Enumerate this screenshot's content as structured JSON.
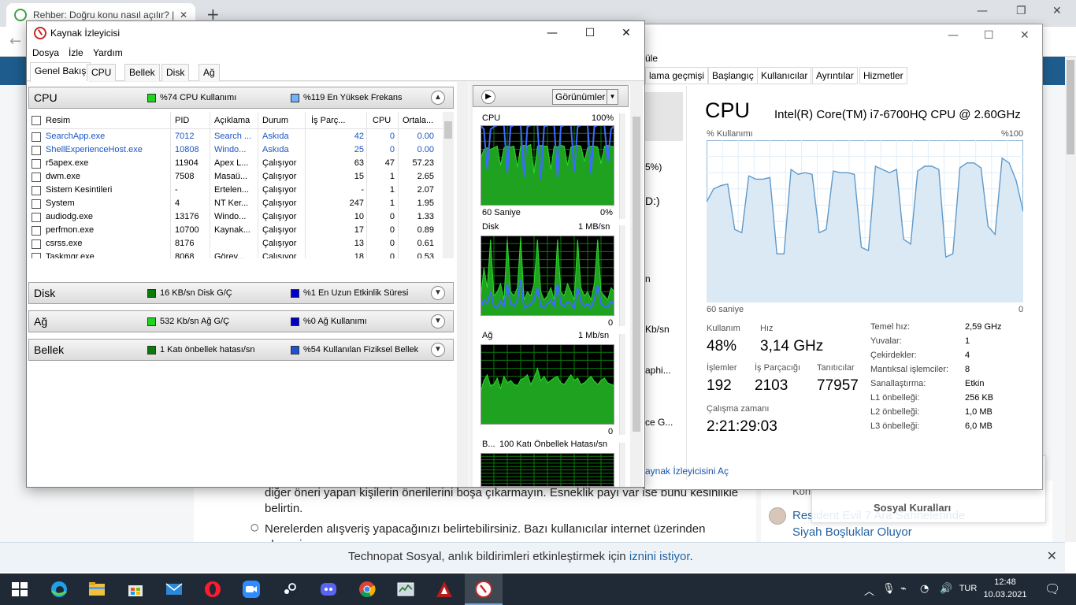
{
  "browser": {
    "tab_title": "Rehber: Doğru konu nasıl açılır? |",
    "tab_close": "✕",
    "new_tab": "+",
    "back": "←",
    "minimize": "—",
    "restore": "❐",
    "close": "✕",
    "article_line1": "diğer öneri yapan kişilerin önerilerini boşa çıkarmayın. Esneklik payı var ise bunu kesinlikle",
    "article_line2": "belirtin.",
    "article_line3": "Nerelerden alışveriş yapacağınızı belirtebilirsiniz. Bazı kullanıcılar internet üzerinden alışveriş",
    "side_prefix": "Kon",
    "side_link": "Resident Evil 7 Ara Sahnelerinde Siyah Boşluklar Oluyor",
    "social_popup_title": "Sosyal Kuralları",
    "notification": {
      "text": "Technopat Sosyal, anlık bildirimleri etkinleştirmek için ",
      "link": "iznini istiyor",
      "suffix": ".",
      "close": "✕"
    }
  },
  "task_manager": {
    "tabs": [
      "üle",
      "lama geçmişi",
      "Başlangıç",
      "Kullanıcılar",
      "Ayrıntılar",
      "Hizmetler"
    ],
    "partial_left": [
      "5%)",
      "D:)",
      "n",
      "Kb/sn",
      "aphi...",
      "ce G..."
    ],
    "title": "CPU",
    "cpu_model": "Intel(R) Core(TM) i7-6700HQ CPU @ 2.60GHz",
    "graph_label_left": "% Kullanımı",
    "graph_label_right": "%100",
    "graph_time_left": "60 saniye",
    "graph_time_right": "0",
    "usage_values": [
      62,
      70,
      72,
      73,
      45,
      43,
      78,
      76,
      76,
      77,
      30,
      30,
      82,
      79,
      80,
      79,
      43,
      45,
      81,
      80,
      80,
      79,
      34,
      32,
      84,
      82,
      80,
      82,
      39,
      36,
      81,
      84,
      84,
      82,
      28,
      30,
      83,
      86,
      86,
      83,
      47,
      42,
      89,
      86,
      75,
      56
    ],
    "stats": {
      "kullanim_label": "Kullanım",
      "kullanim": "48%",
      "hiz_label": "Hız",
      "hiz": "3,14 GHz",
      "islemler_label": "İşlemler",
      "islemler": "192",
      "is_parcacigi_label": "İş Parçacığı",
      "is_parcacigi": "2103",
      "tanitici_label": "Tanıtıcılar",
      "tanitici": "77957",
      "calisma_label": "Çalışma zamanı",
      "calisma": "2:21:29:03"
    },
    "specs": [
      {
        "k": "Temel hız:",
        "v": "2,59 GHz"
      },
      {
        "k": "Yuvalar:",
        "v": "1"
      },
      {
        "k": "Çekirdekler:",
        "v": "4"
      },
      {
        "k": "Mantıksal işlemciler:",
        "v": "8"
      },
      {
        "k": "Sanallaştırma:",
        "v": "Etkin"
      },
      {
        "k": "L1 önbelleği:",
        "v": "256 KB"
      },
      {
        "k": "L2 önbelleği:",
        "v": "1,0 MB"
      },
      {
        "k": "L3 önbelleği:",
        "v": "6,0 MB"
      }
    ],
    "open_resmon_link": "aynak İzleyicisini Aç"
  },
  "resmon": {
    "title": "Kaynak İzleyicisi",
    "minimize": "—",
    "maximize": "☐",
    "close": "✕",
    "menu": [
      "Dosya",
      "İzle",
      "Yardım"
    ],
    "tabs": [
      "Genel Bakış",
      "CPU",
      "Bellek",
      "Disk",
      "Ağ"
    ],
    "cpu_section": {
      "title": "CPU",
      "val1": "%74 CPU Kullanımı",
      "val2": "%119 En Yüksek Frekans",
      "color1": "#1fd31f",
      "color2": "#6fb3ff",
      "chevron": "▲"
    },
    "columns": [
      "Resim",
      "PID",
      "Açıklama",
      "Durum",
      "İş Parç...",
      "CPU",
      "Ortala..."
    ],
    "processes": [
      {
        "name": "SearchApp.exe",
        "pid": "7012",
        "desc": "Search ...",
        "status": "Askıda",
        "threads": "42",
        "cpu": "0",
        "avg": "0.00",
        "blue": true
      },
      {
        "name": "ShellExperienceHost.exe",
        "pid": "10808",
        "desc": "Windo...",
        "status": "Askıda",
        "threads": "25",
        "cpu": "0",
        "avg": "0.00",
        "blue": true
      },
      {
        "name": "r5apex.exe",
        "pid": "11904",
        "desc": "Apex L...",
        "status": "Çalışıyor",
        "threads": "63",
        "cpu": "47",
        "avg": "57.23",
        "blue": false
      },
      {
        "name": "dwm.exe",
        "pid": "7508",
        "desc": "Masaü...",
        "status": "Çalışıyor",
        "threads": "15",
        "cpu": "1",
        "avg": "2.65",
        "blue": false
      },
      {
        "name": "Sistem Kesintileri",
        "pid": "-",
        "desc": "Ertelen...",
        "status": "Çalışıyor",
        "threads": "-",
        "cpu": "1",
        "avg": "2.07",
        "blue": false
      },
      {
        "name": "System",
        "pid": "4",
        "desc": "NT Ker...",
        "status": "Çalışıyor",
        "threads": "247",
        "cpu": "1",
        "avg": "1.95",
        "blue": false
      },
      {
        "name": "audiodg.exe",
        "pid": "13176",
        "desc": "Windo...",
        "status": "Çalışıyor",
        "threads": "10",
        "cpu": "0",
        "avg": "1.33",
        "blue": false
      },
      {
        "name": "perfmon.exe",
        "pid": "10700",
        "desc": "Kaynak...",
        "status": "Çalışıyor",
        "threads": "17",
        "cpu": "0",
        "avg": "0.89",
        "blue": false
      },
      {
        "name": "csrss.exe",
        "pid": "8176",
        "desc": "",
        "status": "Çalışıyor",
        "threads": "13",
        "cpu": "0",
        "avg": "0.61",
        "blue": false
      },
      {
        "name": "Taskmgr.exe",
        "pid": "8068",
        "desc": "Görev...",
        "status": "Çalışıyor",
        "threads": "18",
        "cpu": "0",
        "avg": "0.53",
        "blue": false
      }
    ],
    "sections": [
      {
        "name": "disk",
        "title": "Disk",
        "val1": "16 KB/sn Disk G/Ç",
        "val2": "%1 En Uzun Etkinlik Süresi",
        "color1": "#0a7a0a",
        "color2": "#0000c8",
        "chevron": "▼"
      },
      {
        "name": "ag",
        "title": "Ağ",
        "val1": "532 Kb/sn Ağ G/Ç",
        "val2": "%0 Ağ Kullanımı",
        "color1": "#1fd31f",
        "color2": "#0000c8",
        "chevron": "▼"
      },
      {
        "name": "bellek",
        "title": "Bellek",
        "val1": "1 Katı önbellek hatası/sn",
        "val2": "%54 Kullanılan Fiziksel Bellek",
        "color1": "#0a7a0a",
        "color2": "#1f4fd3",
        "chevron": "▼"
      }
    ],
    "right": {
      "play": "▶",
      "views_label": "Görünümler",
      "views_dd": "▼",
      "cpu_graph": {
        "label": "CPU",
        "max": "100%",
        "time": "60 Saniye",
        "min": "0%"
      },
      "disk_graph": {
        "label": "Disk",
        "max": "1 MB/sn",
        "min": "0"
      },
      "net_graph": {
        "label": "Ağ",
        "max": "1 Mb/sn",
        "min": "0"
      },
      "mem_graph": {
        "label": "B...",
        "max": "100 Katı Önbellek Hatası/sn"
      },
      "cpu_green": [
        58,
        70,
        72,
        70,
        72,
        74,
        50,
        72,
        74,
        73,
        74,
        48,
        74,
        75,
        74,
        76,
        40,
        74,
        75,
        74,
        74,
        45,
        74,
        73,
        75,
        74,
        50,
        73,
        74,
        75,
        74,
        55,
        72,
        74,
        74,
        73,
        52,
        74,
        75,
        74,
        73
      ],
      "cpu_blue": [
        100,
        95,
        45,
        95,
        98,
        100,
        100,
        100,
        40,
        98,
        100,
        100,
        100,
        35,
        98,
        100,
        100,
        100,
        32,
        98,
        100,
        100,
        100,
        35,
        98,
        100,
        100,
        100,
        42,
        98,
        100,
        100,
        100,
        40,
        98,
        100,
        100,
        100,
        55,
        95,
        100
      ],
      "disk_green": [
        20,
        60,
        35,
        95,
        25,
        30,
        40,
        20,
        95,
        30,
        25,
        35,
        98,
        20,
        30,
        25,
        40,
        95,
        30,
        20,
        25,
        35,
        20,
        95,
        30,
        25,
        40,
        30,
        20,
        95,
        35,
        25,
        30,
        20,
        40,
        95,
        30,
        25,
        20,
        35,
        30
      ],
      "disk_blue": [
        10,
        20,
        15,
        30,
        12,
        10,
        18,
        12,
        40,
        15,
        12,
        20,
        45,
        10,
        12,
        15,
        20,
        35,
        12,
        10,
        15,
        20,
        12,
        40,
        15,
        12,
        18,
        15,
        10,
        35,
        18,
        12,
        15,
        10,
        20,
        38,
        15,
        12,
        10,
        18,
        15
      ],
      "net_green": [
        40,
        55,
        62,
        48,
        50,
        58,
        45,
        60,
        52,
        55,
        50,
        48,
        56,
        58,
        62,
        50,
        58,
        70,
        55,
        60,
        52,
        55,
        58,
        60,
        52,
        50,
        56,
        62,
        55,
        58,
        50,
        52,
        56,
        60,
        54,
        50,
        55,
        58,
        52,
        50,
        48
      ]
    }
  },
  "taskbar": {
    "lang": "TUR",
    "time": "12:48",
    "date": "10.03.2021",
    "tray_up": "︿",
    "notification_glyph": "🗨"
  }
}
